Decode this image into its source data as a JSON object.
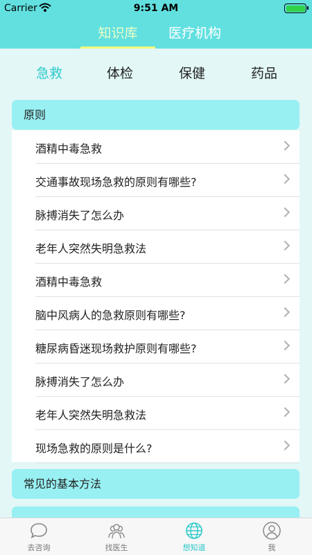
{
  "status_bar": {
    "carrier": "Carrier",
    "time": "9:51 AM"
  },
  "top_nav": {
    "tabs": [
      "知识库",
      "医疗机构"
    ],
    "active_tab": "知识库"
  },
  "category_tabs": {
    "items": [
      "急救",
      "体检",
      "保健",
      "药品"
    ],
    "active": "急救"
  },
  "sections": [
    {
      "title": "原则",
      "items": [
        "酒精中毒急救",
        "交通事故现场急救的原则有哪些?",
        "脉搏消失了怎么办",
        "老年人突然失明急救法",
        "酒精中毒急救",
        "脑中风病人的急救原则有哪些?",
        "糖尿病昏迷现场救护原则有哪些?",
        "脉搏消失了怎么办",
        "老年人突然失明急救法",
        "现场急救的原则是什么?"
      ]
    },
    {
      "title": "常见的基本方法"
    }
  ],
  "bottom_tabs": {
    "items": [
      "去咨询",
      "找医生",
      "想知道",
      "我"
    ],
    "active": "想知道"
  },
  "colors": {
    "brand": "#62e0e0",
    "accent": "#2cc9c9",
    "header_bg": "#98f0f2",
    "content_bg": "#e3f7f7"
  }
}
